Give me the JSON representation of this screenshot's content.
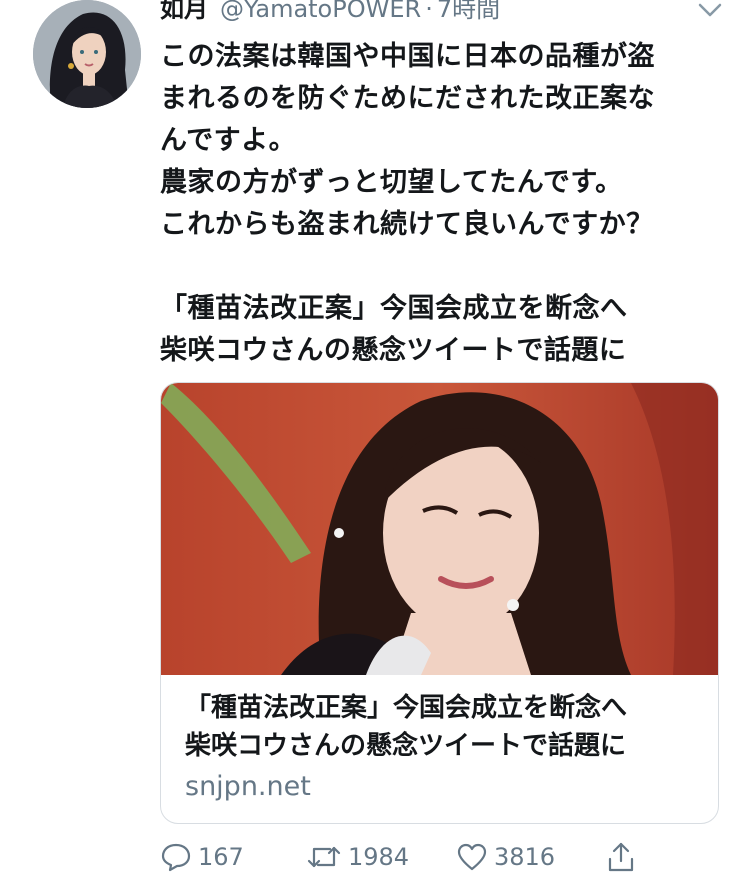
{
  "tweet": {
    "author_name": "如月",
    "author_handle": "@YamatoPOWER",
    "separator": "·",
    "time": "7時間",
    "text_lines": [
      "この法案は韓国や中国に日本の品種が盗",
      "まれるのを防ぐためにだされた改正案な",
      "んですよ。",
      "農家の方がずっと切望してたんです。",
      "これからも盗まれ続けて良いんですか？",
      "",
      "「種苗法改正案」今国会成立を断念へ",
      "柴咲コウさんの懸念ツイートで話題に"
    ]
  },
  "card": {
    "title_lines": [
      "「種苗法改正案」今国会成立を断念へ",
      "柴咲コウさんの懸念ツイートで話題に"
    ],
    "domain": "snjpn.net"
  },
  "actions": {
    "replies": "167",
    "retweets": "1984",
    "likes": "3816"
  },
  "icons": {
    "reply": "reply-icon",
    "retweet": "retweet-icon",
    "like": "heart-icon",
    "share": "share-icon",
    "more": "chevron-down-icon"
  },
  "colors": {
    "text": "#14171a",
    "secondary": "#657786",
    "border": "#d8dde2"
  }
}
